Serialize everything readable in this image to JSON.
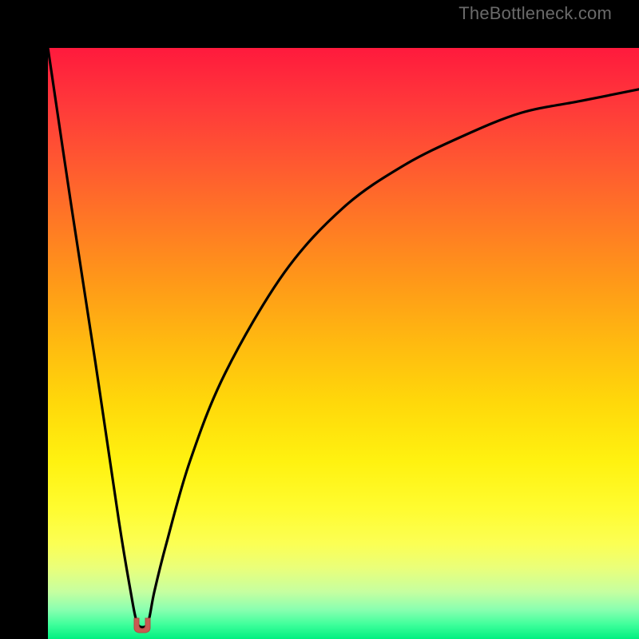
{
  "watermark": "TheBottleneck.com",
  "colors": {
    "frame": "#000000",
    "curve": "#000000",
    "marker_fill": "#c95a52",
    "marker_stroke": "#b24841"
  },
  "chart_data": {
    "type": "line",
    "title": "",
    "xlabel": "",
    "ylabel": "",
    "xlim": [
      0,
      100
    ],
    "ylim": [
      0,
      100
    ],
    "grid": false,
    "legend": false,
    "curve_comment": "V-shaped bottleneck curve; y is a qualitative mismatch percentage (0 = ideal, 100 = worst). Optimum at x≈16.",
    "x": [
      0,
      4,
      8,
      12,
      14,
      15,
      16,
      17,
      18,
      20,
      24,
      30,
      40,
      50,
      60,
      70,
      80,
      90,
      100
    ],
    "y": [
      100,
      73,
      47,
      20,
      8,
      3,
      2,
      3,
      8,
      16,
      30,
      45,
      62,
      73,
      80,
      85,
      89,
      91,
      93
    ],
    "optimum": {
      "x": 16,
      "y": 2
    }
  }
}
